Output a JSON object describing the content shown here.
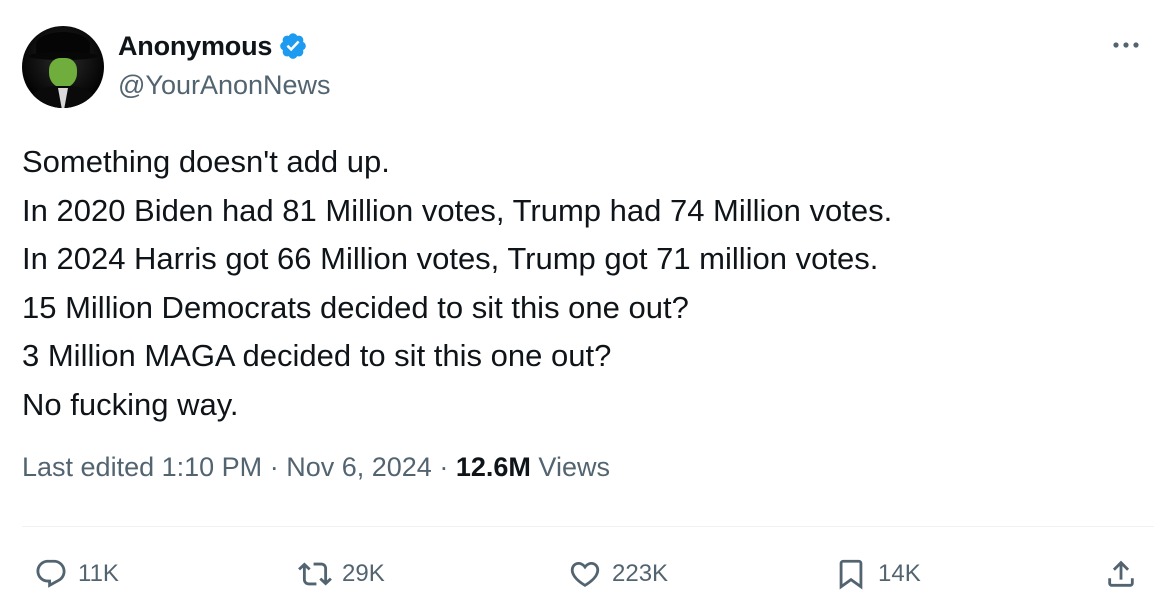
{
  "author": {
    "display_name": "Anonymous",
    "handle": "@YourAnonNews",
    "verified": true
  },
  "tweet": {
    "lines": [
      "Something doesn't add up.",
      "In 2020 Biden had 81 Million votes, Trump had 74 Million votes.",
      "In 2024 Harris got 66 Million votes, Trump got 71 million votes.",
      "15 Million Democrats decided to sit this one out?",
      "3 Million MAGA decided to sit this one out?",
      "No fucking way."
    ],
    "edited_label": "Last edited",
    "time": "1:10 PM",
    "date": "Nov 6, 2024",
    "separator": "·",
    "views_count": "12.6M",
    "views_label": "Views"
  },
  "actions": {
    "replies": "11K",
    "reposts": "29K",
    "likes": "223K",
    "bookmarks": "14K"
  },
  "icons": {
    "verified": "verified-badge-icon",
    "more": "more-horizontal-icon",
    "reply": "reply-bubble-icon",
    "repost": "repost-arrows-icon",
    "like": "heart-icon",
    "bookmark": "bookmark-icon",
    "share": "share-upload-icon"
  },
  "colors": {
    "accent": "#1d9bf0",
    "text": "#0f1419",
    "muted": "#536471"
  }
}
